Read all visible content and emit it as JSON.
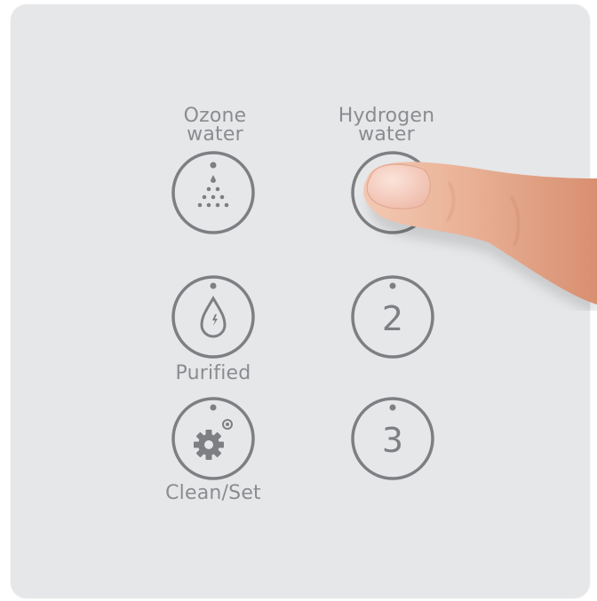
{
  "panel": {
    "buttons": [
      {
        "id": "ozone",
        "label": "Ozone\nwater",
        "icon": "ozone-droplets-icon"
      },
      {
        "id": "hydrogen",
        "label": "Hydrogen\nwater",
        "icon": "blank",
        "pressed": true
      },
      {
        "id": "purified",
        "label": "Purified",
        "icon": "water-drop-icon"
      },
      {
        "id": "two",
        "number": "2"
      },
      {
        "id": "clean",
        "label": "Clean/Set",
        "icon": "gear-icon"
      },
      {
        "id": "three",
        "number": "3"
      }
    ]
  },
  "colors": {
    "panel_bg": "#e6e7e9",
    "icon_gray": "#7d7f82",
    "label_gray": "#8a8c8f"
  }
}
